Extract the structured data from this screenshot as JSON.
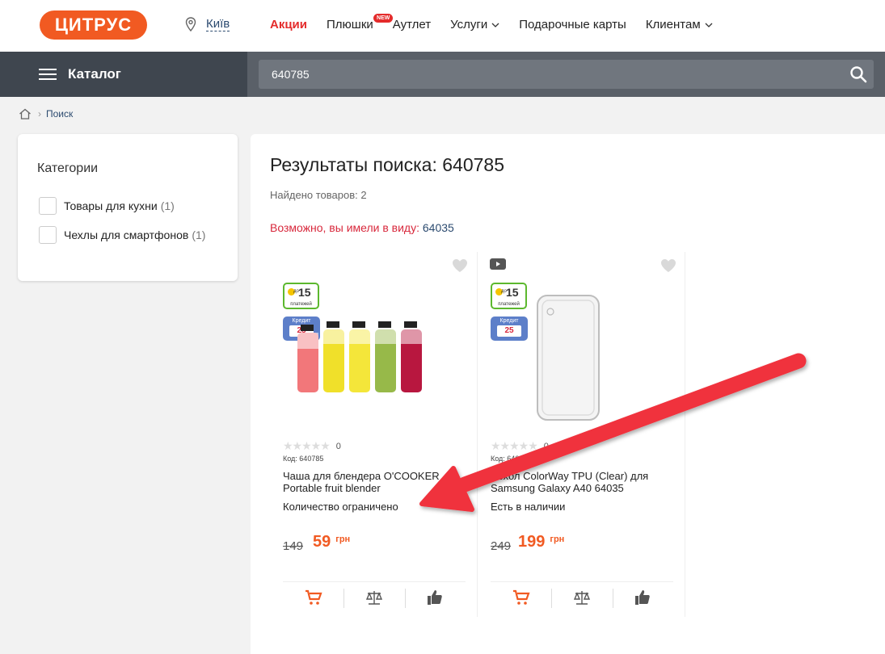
{
  "header": {
    "logo_text": "ЦИТРУС",
    "city": "Київ",
    "nav": [
      {
        "label": "Акции"
      },
      {
        "label": "Плюшки",
        "badge": "NEW"
      },
      {
        "label": "Аутлет"
      },
      {
        "label": "Услуги"
      },
      {
        "label": "Подарочные карты"
      },
      {
        "label": "Клиентам"
      }
    ]
  },
  "toolbar": {
    "catalog_label": "Каталог",
    "search_value": "640785"
  },
  "breadcrumb": {
    "current": "Поиск"
  },
  "sidebar": {
    "title": "Категории",
    "filters": [
      {
        "label": "Товары для кухни",
        "count": "(1)"
      },
      {
        "label": "Чехлы для смартфонов",
        "count": "(1)"
      }
    ]
  },
  "results": {
    "title": "Результаты поиска: 640785",
    "found": "Найдено товаров: 2",
    "suggest_prefix": "Возможно, вы имели в виду:",
    "suggest_link": "64035"
  },
  "products": [
    {
      "promo_installments": "15",
      "promo_installments_prefix": "до",
      "promo_installments_sub": "платежей",
      "credit_label": "Кредит",
      "credit_value": "25",
      "rating_count": "0",
      "code": "Код: 640785",
      "name": "Чаша для блендера O'COOKER Portable fruit blender",
      "stock": "Количество ограничено",
      "old_price": "149",
      "price": "59",
      "currency": "грн"
    },
    {
      "promo_installments": "15",
      "promo_installments_prefix": "до",
      "promo_installments_sub": "платежей",
      "credit_label": "Кредит",
      "credit_value": "25",
      "rating_count": "0",
      "code": "Код: 6403",
      "name": "Чехол ColorWay TPU (Clear) для Samsung Galaxy A40 64035",
      "stock": "Есть в наличии",
      "old_price": "249",
      "price": "199",
      "currency": "грн"
    }
  ],
  "colors": {
    "brand": "#f15a22",
    "accent_red": "#e42b2b",
    "annotation_arrow": "#f0323e"
  }
}
